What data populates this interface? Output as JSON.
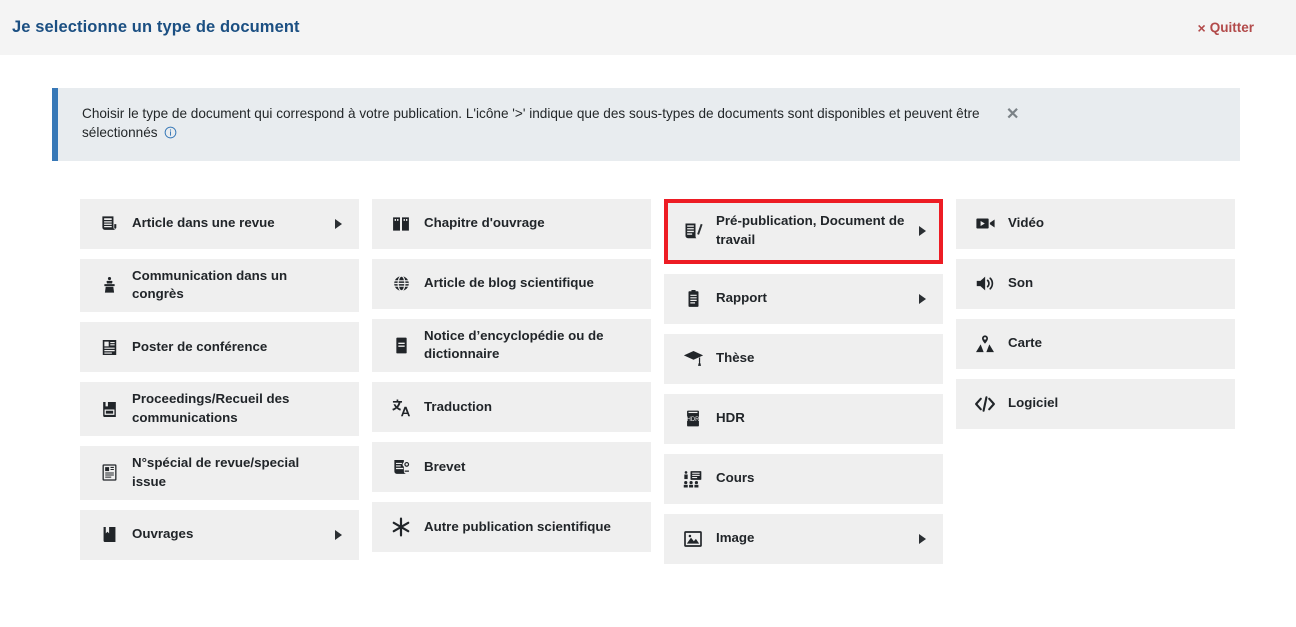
{
  "header": {
    "title": "Je selectionne un type de document",
    "quit_label": "Quitter",
    "quit_x": "×",
    "title_color": "#1b4f82",
    "quit_color": "#b24a4a",
    "background": "#f4f4f4"
  },
  "banner": {
    "text": "Choisir le type de document qui correspond à votre publication. L'icône '>' indique que des sous-types de documents sont disponibles et peuvent être sélectionnés",
    "info_icon": "info-circle-icon",
    "close_label": "✕",
    "accent_color": "#3778b7",
    "background": "#e8ecef"
  },
  "highlight": {
    "color": "#ed1c24",
    "target": "Pré-publication, Document de travail"
  },
  "columns": [
    {
      "id": "col-1",
      "items": [
        {
          "label": "Article dans une revue",
          "icon": "article-journal-icon",
          "has_subtypes": true
        },
        {
          "label": "Communication dans un congrès",
          "icon": "lectern-icon",
          "has_subtypes": false
        },
        {
          "label": "Poster de conférence",
          "icon": "poster-icon",
          "has_subtypes": false
        },
        {
          "label": "Proceedings/Recueil des communications",
          "icon": "proceedings-book-icon",
          "has_subtypes": false
        },
        {
          "label": "N°spécial de revue/special issue",
          "icon": "special-issue-icon",
          "has_subtypes": false
        },
        {
          "label": "Ouvrages",
          "icon": "book-icon",
          "has_subtypes": true
        }
      ]
    },
    {
      "id": "col-2",
      "items": [
        {
          "label": "Chapitre d'ouvrage",
          "icon": "open-book-icon",
          "has_subtypes": false
        },
        {
          "label": "Article de blog scientifique",
          "icon": "globe-icon",
          "has_subtypes": false
        },
        {
          "label": "Notice d’encyclopédie ou de dictionnaire",
          "icon": "encyclopedia-icon",
          "has_subtypes": false
        },
        {
          "label": "Traduction",
          "icon": "translate-icon",
          "has_subtypes": false
        },
        {
          "label": "Brevet",
          "icon": "patent-icon",
          "has_subtypes": false
        },
        {
          "label": "Autre publication scientifique",
          "icon": "asterisk-icon",
          "has_subtypes": false
        }
      ]
    },
    {
      "id": "col-3",
      "items": [
        {
          "label": "Pré-publication, Document de travail",
          "icon": "preprint-icon",
          "has_subtypes": true,
          "highlighted": true
        },
        {
          "label": "Rapport",
          "icon": "clipboard-icon",
          "has_subtypes": true
        },
        {
          "label": "Thèse",
          "icon": "graduation-cap-icon",
          "has_subtypes": false
        },
        {
          "label": "HDR",
          "icon": "hdr-book-icon",
          "has_subtypes": false
        },
        {
          "label": "Cours",
          "icon": "course-board-icon",
          "has_subtypes": false
        },
        {
          "label": "Image",
          "icon": "image-icon",
          "has_subtypes": true
        }
      ]
    },
    {
      "id": "col-4",
      "items": [
        {
          "label": "Vidéo",
          "icon": "video-camera-icon",
          "has_subtypes": false
        },
        {
          "label": "Son",
          "icon": "speaker-icon",
          "has_subtypes": false
        },
        {
          "label": "Carte",
          "icon": "map-pin-icon",
          "has_subtypes": false
        },
        {
          "label": "Logiciel",
          "icon": "code-icon",
          "has_subtypes": false
        }
      ]
    }
  ]
}
